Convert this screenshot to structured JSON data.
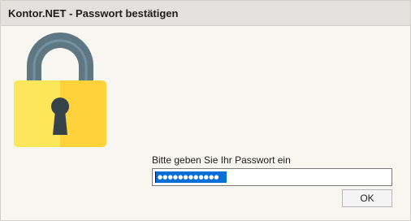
{
  "window": {
    "title": "Kontor.NET - Passwort bestätigen"
  },
  "dialog": {
    "icon": "padlock-icon",
    "prompt": "Bitte geben Sie Ihr Passwort ein",
    "password_masked": "●●●●●●●●●●●●",
    "ok_label": "OK"
  },
  "colors": {
    "background": "#f8f6f1",
    "titlebar": "#e2e1dd",
    "lock_body": "#ffd23b",
    "lock_shackle": "#5f7683",
    "keyhole": "#35424a",
    "selection": "#0a6fd6"
  }
}
